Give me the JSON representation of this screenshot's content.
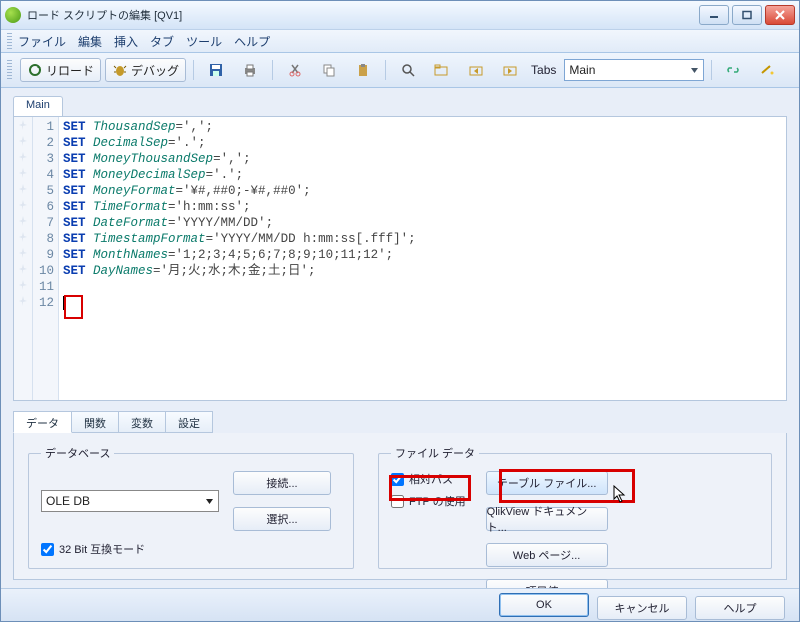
{
  "window": {
    "title": "ロード スクリプトの編集 [QV1]"
  },
  "menu": {
    "file": "ファイル",
    "edit": "編集",
    "insert": "挿入",
    "tab": "タブ",
    "tools": "ツール",
    "help": "ヘルプ"
  },
  "toolbar": {
    "reload": "リロード",
    "debug": "デバッグ",
    "tabs_label": "Tabs",
    "tabs_value": "Main"
  },
  "file_tabs": {
    "main": "Main"
  },
  "script": {
    "lines": [
      {
        "n": 1,
        "kw": "SET",
        "id": "ThousandSep",
        "rest": "=',';"
      },
      {
        "n": 2,
        "kw": "SET",
        "id": "DecimalSep",
        "rest": "='.';"
      },
      {
        "n": 3,
        "kw": "SET",
        "id": "MoneyThousandSep",
        "rest": "=',';"
      },
      {
        "n": 4,
        "kw": "SET",
        "id": "MoneyDecimalSep",
        "rest": "='.';"
      },
      {
        "n": 5,
        "kw": "SET",
        "id": "MoneyFormat",
        "rest": "='¥#,##0;-¥#,##0';"
      },
      {
        "n": 6,
        "kw": "SET",
        "id": "TimeFormat",
        "rest": "='h:mm:ss';"
      },
      {
        "n": 7,
        "kw": "SET",
        "id": "DateFormat",
        "rest": "='YYYY/MM/DD';"
      },
      {
        "n": 8,
        "kw": "SET",
        "id": "TimestampFormat",
        "rest": "='YYYY/MM/DD h:mm:ss[.fff]';"
      },
      {
        "n": 9,
        "kw": "SET",
        "id": "MonthNames",
        "rest": "='1;2;3;4;5;6;7;8;9;10;11;12';"
      },
      {
        "n": 10,
        "kw": "SET",
        "id": "DayNames",
        "rest": "='月;火;水;木;金;土;日';"
      },
      {
        "n": 11,
        "kw": "",
        "id": "",
        "rest": ""
      },
      {
        "n": 12,
        "kw": "",
        "id": "",
        "rest": ""
      }
    ]
  },
  "bottom": {
    "tab1": "データ",
    "tab2": "関数",
    "tab3": "変数",
    "tab4": "設定"
  },
  "db": {
    "legend": "データベース",
    "oledb": "OLE DB",
    "connect": "接続...",
    "select": "選択...",
    "compat": "32 Bit 互換モード"
  },
  "filedata": {
    "legend": "ファイル データ",
    "relpath": "相対パス",
    "useftp": "FTP の使用",
    "tablefile": "テーブル ファイル...",
    "qvdoc": "QlikView ドキュメント...",
    "webpage": "Web ページ...",
    "fieldval": "項目値..."
  },
  "footer": {
    "ok": "OK",
    "cancel": "キャンセル",
    "help": "ヘルプ"
  }
}
